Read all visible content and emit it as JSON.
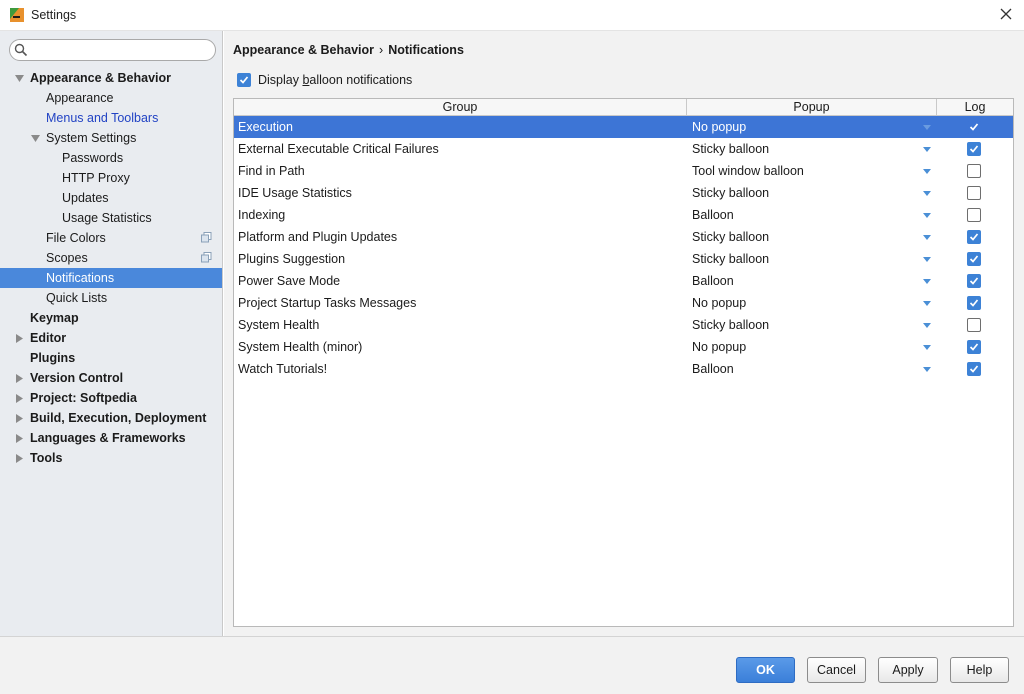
{
  "window": {
    "title": "Settings"
  },
  "sidebar": {
    "search_placeholder": "",
    "items": [
      {
        "label": "Appearance & Behavior",
        "level": 0,
        "bold": true,
        "expanded": true
      },
      {
        "label": "Appearance",
        "level": 1
      },
      {
        "label": "Menus and Toolbars",
        "level": 1,
        "link": true
      },
      {
        "label": "System Settings",
        "level": 1,
        "expanded": true
      },
      {
        "label": "Passwords",
        "level": 2
      },
      {
        "label": "HTTP Proxy",
        "level": 2
      },
      {
        "label": "Updates",
        "level": 2
      },
      {
        "label": "Usage Statistics",
        "level": 2
      },
      {
        "label": "File Colors",
        "level": 1,
        "icon": "copy-icon"
      },
      {
        "label": "Scopes",
        "level": 1,
        "icon": "copy-icon"
      },
      {
        "label": "Notifications",
        "level": 1,
        "selected": true
      },
      {
        "label": "Quick Lists",
        "level": 1
      },
      {
        "label": "Keymap",
        "level": 0,
        "bold": true
      },
      {
        "label": "Editor",
        "level": 0,
        "bold": true,
        "collapsed": true
      },
      {
        "label": "Plugins",
        "level": 0,
        "bold": true
      },
      {
        "label": "Version Control",
        "level": 0,
        "bold": true,
        "collapsed": true
      },
      {
        "label": "Project: Softpedia",
        "level": 0,
        "bold": true,
        "collapsed": true
      },
      {
        "label": "Build, Execution, Deployment",
        "level": 0,
        "bold": true,
        "collapsed": true
      },
      {
        "label": "Languages & Frameworks",
        "level": 0,
        "bold": true,
        "collapsed": true
      },
      {
        "label": "Tools",
        "level": 0,
        "bold": true,
        "collapsed": true
      }
    ]
  },
  "breadcrumb": {
    "parent": "Appearance & Behavior",
    "separator": "›",
    "current": "Notifications"
  },
  "display_balloon": {
    "label_pre": "Display ",
    "label_mnemonic": "b",
    "label_post": "alloon notifications",
    "checked": true
  },
  "table": {
    "headers": {
      "group": "Group",
      "popup": "Popup",
      "log": "Log"
    },
    "rows": [
      {
        "group": "Execution",
        "popup": "No popup",
        "log": true,
        "selected": true
      },
      {
        "group": "External Executable Critical Failures",
        "popup": "Sticky balloon",
        "log": true
      },
      {
        "group": "Find in Path",
        "popup": "Tool window balloon",
        "log": false
      },
      {
        "group": "IDE Usage Statistics",
        "popup": "Sticky balloon",
        "log": false
      },
      {
        "group": "Indexing",
        "popup": "Balloon",
        "log": false
      },
      {
        "group": "Platform and Plugin Updates",
        "popup": "Sticky balloon",
        "log": true
      },
      {
        "group": "Plugins Suggestion",
        "popup": "Sticky balloon",
        "log": true
      },
      {
        "group": "Power Save Mode",
        "popup": "Balloon",
        "log": true
      },
      {
        "group": "Project Startup Tasks Messages",
        "popup": "No popup",
        "log": true
      },
      {
        "group": "System Health",
        "popup": "Sticky balloon",
        "log": false
      },
      {
        "group": "System Health (minor)",
        "popup": "No popup",
        "log": true
      },
      {
        "group": "Watch Tutorials!",
        "popup": "Balloon",
        "log": true
      }
    ]
  },
  "buttons": {
    "ok": "OK",
    "cancel": "Cancel",
    "apply": "Apply",
    "help": "Help"
  },
  "colors": {
    "accent": "#3d82d6",
    "selection": "#4a88db",
    "link": "#2243c4"
  }
}
